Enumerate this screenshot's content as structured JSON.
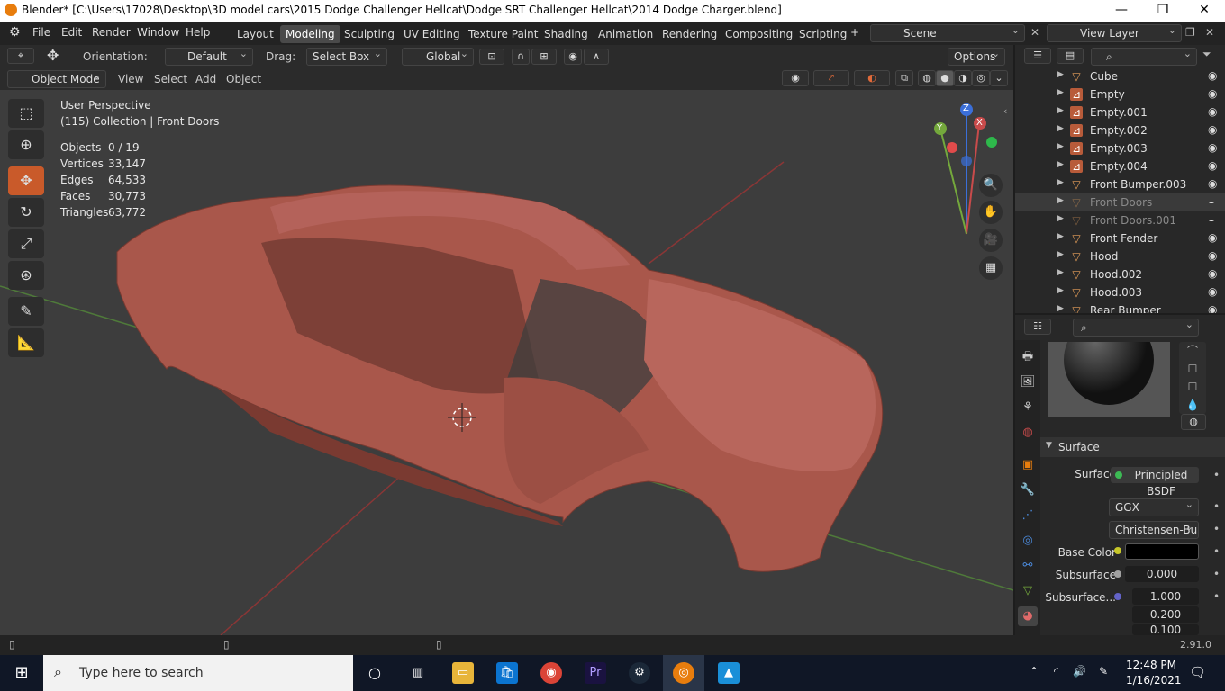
{
  "window": {
    "title": "Blender* [C:\\Users\\17028\\Desktop\\3D model cars\\2015 Dodge Challenger Hellcat\\Dodge SRT Challenger Hellcat\\2014 Dodge Charger.blend]",
    "minimize": "—",
    "maximize": "❐",
    "close": "✕"
  },
  "menus": [
    "File",
    "Edit",
    "Render",
    "Window",
    "Help"
  ],
  "workspaces": [
    "Layout",
    "Modeling",
    "Sculpting",
    "UV Editing",
    "Texture Paint",
    "Shading",
    "Animation",
    "Rendering",
    "Compositing",
    "Scripting"
  ],
  "active_workspace": "Modeling",
  "scene": {
    "label": "Scene"
  },
  "view_layer": {
    "label": "View Layer"
  },
  "tool_header": {
    "orientation_label": "Orientation:",
    "orientation_value": "Default",
    "drag_label": "Drag:",
    "drag_value": "Select Box",
    "transform_value": "Global",
    "options_label": "Options"
  },
  "view_header": {
    "mode": "Object Mode",
    "menus": [
      "View",
      "Select",
      "Add",
      "Object"
    ]
  },
  "viewport": {
    "perspective": "User Perspective",
    "collection": "(115) Collection | Front Doors",
    "stats": [
      {
        "label": "Objects",
        "value": "0 / 19"
      },
      {
        "label": "Vertices",
        "value": "33,147"
      },
      {
        "label": "Edges",
        "value": "64,533"
      },
      {
        "label": "Faces",
        "value": "30,773"
      },
      {
        "label": "Triangles",
        "value": "63,772"
      }
    ],
    "gizmo": {
      "x": "X",
      "y": "Y",
      "z": "Z"
    },
    "model_color": "#a9574b"
  },
  "outliner": {
    "items": [
      {
        "name": "Cube",
        "type": "mesh",
        "dim": false,
        "sel": false
      },
      {
        "name": "Empty",
        "type": "empty",
        "dim": false,
        "sel": false
      },
      {
        "name": "Empty.001",
        "type": "empty",
        "dim": false,
        "sel": false
      },
      {
        "name": "Empty.002",
        "type": "empty",
        "dim": false,
        "sel": false
      },
      {
        "name": "Empty.003",
        "type": "empty",
        "dim": false,
        "sel": false
      },
      {
        "name": "Empty.004",
        "type": "empty",
        "dim": false,
        "sel": false
      },
      {
        "name": "Front Bumper.003",
        "type": "mesh",
        "dim": false,
        "sel": false
      },
      {
        "name": "Front Doors",
        "type": "mesh",
        "dim": true,
        "sel": true
      },
      {
        "name": "Front Doors.001",
        "type": "mesh",
        "dim": true,
        "sel": false
      },
      {
        "name": "Front Fender",
        "type": "mesh",
        "dim": false,
        "sel": false
      },
      {
        "name": "Hood",
        "type": "mesh",
        "dim": false,
        "sel": false
      },
      {
        "name": "Hood.002",
        "type": "mesh",
        "dim": false,
        "sel": false
      },
      {
        "name": "Hood.003",
        "type": "mesh",
        "dim": false,
        "sel": false
      },
      {
        "name": "Rear Bumper",
        "type": "mesh",
        "dim": false,
        "sel": false
      }
    ]
  },
  "properties": {
    "section": "Surface",
    "surface_label": "Surface",
    "surface_value": "Principled BSDF",
    "distribution": "GGX",
    "subsurface_method": "Christensen-Bu...",
    "base_color_label": "Base Color",
    "base_color": "#000000",
    "subsurface_label": "Subsurface",
    "subsurface_value": "0.000",
    "subsurface_radius_label": "Subsurface...",
    "subsurface_radius": [
      "1.000",
      "0.200",
      "0.100"
    ]
  },
  "status": {
    "version": "2.91.0"
  },
  "taskbar": {
    "search_placeholder": "Type here to search",
    "time": "12:48 PM",
    "date": "1/16/2021"
  }
}
